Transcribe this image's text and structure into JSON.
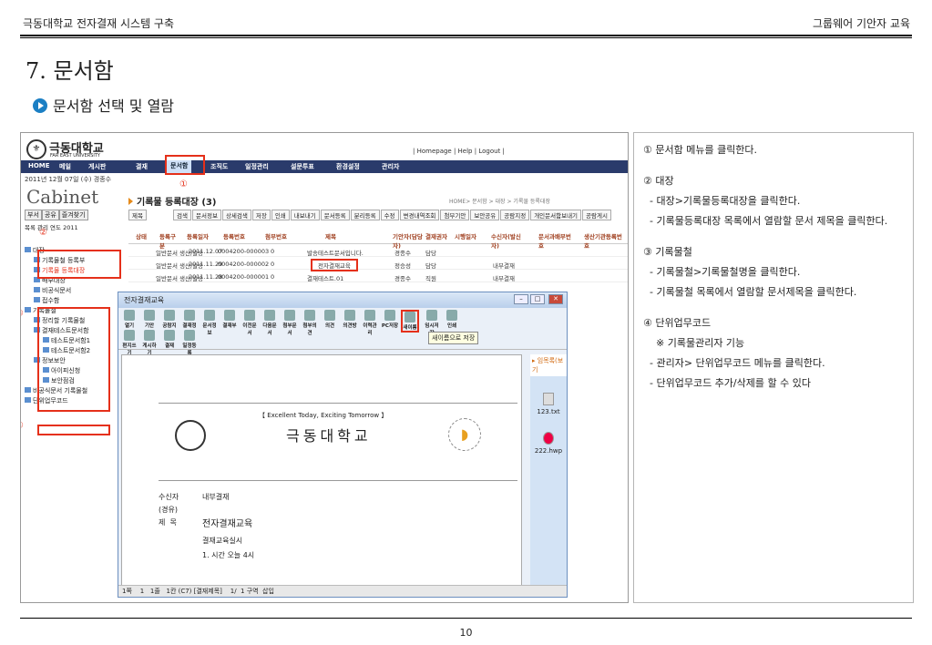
{
  "header": {
    "left": "극동대학교 전자결재 시스템 구축",
    "right": "그룹웨어 기안자 교육"
  },
  "section_title": "7. 문서함",
  "subsection_title": "문서함 선택 및 열람",
  "page_number": "10",
  "screenshot": {
    "logo": "극동대학교",
    "logo_sub": "FAR EAST UNIVERSITY",
    "top_links": "| Homepage | Help | Logout |",
    "nav": [
      "HOME",
      "메일",
      "게시판",
      "결재",
      "문서함",
      "조직도",
      "일정관리",
      "설문투표",
      "환경설정",
      "관리자"
    ],
    "date": "2011년 12월 07일 (수) 경종수",
    "cabinet": "Cabinet",
    "page_title": "기록물 등록대장 (3)",
    "breadcrumb": "HOME> 문서함 > 대장 > 기록물 등록대장",
    "left_tabs": [
      "부서",
      "공유",
      "즐겨찾기"
    ],
    "left_filter": "목록 관리 연도 2011",
    "search_select": "제목",
    "toolbar": [
      "검색",
      "문서정보",
      "상세검색",
      "저장",
      "인쇄",
      "내보내기",
      "문서등록",
      "분리등록",
      "수정",
      "변경내역조회",
      "첨부기안",
      "보안공유",
      "공람지정",
      "개인문서함보내기",
      "공람게시"
    ],
    "table_headers": [
      "상태",
      "등록구분",
      "등록일자",
      "등록번호",
      "첨부번호",
      "제목",
      "기안자(담당자)",
      "결재권자",
      "시행일자",
      "수신자(발신자)",
      "문서과배부번호",
      "생산기관등록번호"
    ],
    "rows": [
      {
        "kind": "일반문서 생산/발송",
        "date": "2011.12.07",
        "no": "0004200-000003",
        "att": "0",
        "title": "발송테스트문서입니다.",
        "drafter": "경종수",
        "approver": "담당",
        "recv": ""
      },
      {
        "kind": "일반문서 생산/발송",
        "date": "2011.11.29",
        "no": "0004200-000002",
        "att": "0",
        "title": "전자결재교육",
        "drafter": "정승성",
        "approver": "담당",
        "recv": "내부결재"
      },
      {
        "kind": "일반문서 생산/발송",
        "date": "2011.11.28",
        "no": "0004200-000001",
        "att": "0",
        "title": "결재테스트.01",
        "drafter": "경종수",
        "approver": "직원",
        "recv": "내부결재"
      }
    ],
    "tree": [
      "대장",
      "기록물철 등록부",
      "기록물 등록대장",
      "배부대장",
      "비공식문서",
      "접수함",
      "기록물철",
      "정리할 기록물철",
      "결재테스트문서함",
      "테스트문서함1",
      "테스트문서함2",
      "정보보안",
      "아이피신청",
      "보안점검",
      "비공식문서 기록물철",
      "단위업무코드"
    ],
    "markers": [
      "①",
      "②",
      "③",
      "④"
    ],
    "popup": {
      "title": "전자결재교육",
      "tools": [
        "열기",
        "기안",
        "공람지정",
        "결재정보",
        "문서정보",
        "결재부",
        "이전문서",
        "다음문서",
        "첨부문서",
        "첨부의견",
        "의견",
        "의견방",
        "이력관리",
        "PC저장",
        "새이름",
        "임시저장",
        "인쇄",
        "편지쓰기",
        "게시하기",
        "결재",
        "일정등록"
      ],
      "tooltip": "새이름으로 저장",
      "slogan": "【 Excellent Today, Exciting Tomorrow 】",
      "univ": "극동대학교",
      "recipient_label": "수신자",
      "recipient": "내부결재",
      "via_label": "(경유)",
      "subject_label": "제  목",
      "subject": "전자결재교육",
      "body1": "결재교육실시",
      "body2": "1. 시간 오늘 4시",
      "side_tab": "▸ 임목록(보기",
      "files": [
        "123.txt",
        "222.hwp"
      ],
      "status": "1쪽    1   1줄   1칸 (C7) [결재제목]    1/  1 구역  삽입"
    }
  },
  "notes": [
    "① 문서함 메뉴를 클릭한다.",
    "② 대장",
    "  - 대장>기록물등록대장을 클릭한다.",
    "  - 기록물등록대장 목록에서 열람할 문서 제목을 클릭한다.",
    "③ 기록물철",
    "  - 기록물철>기록물철명을 클릭한다.",
    "  - 기록물철 목록에서 열람할 문서제목을 클릭한다.",
    "④ 단위업무코드",
    "    ※ 기록물관리자 기능",
    "  - 관리자> 단위업무코드 메뉴를 클릭한다.",
    "  - 단위업무코드 추가/삭제를 할 수 있다"
  ]
}
